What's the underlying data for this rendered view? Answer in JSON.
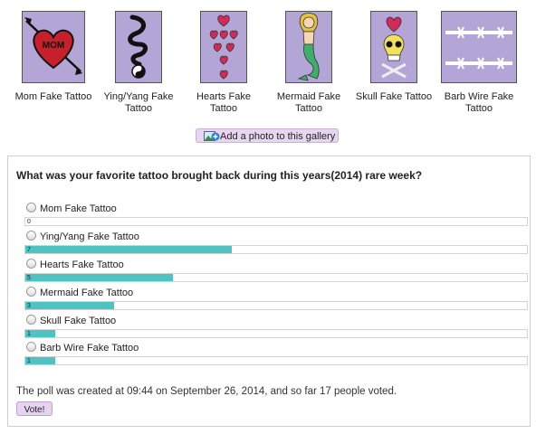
{
  "gallery": {
    "items": [
      {
        "caption": "Mom Fake Tattoo",
        "art_text": "MOM"
      },
      {
        "caption": "Ying/Yang Fake Tattoo"
      },
      {
        "caption": "Hearts Fake Tattoo"
      },
      {
        "caption": "Mermaid Fake Tattoo"
      },
      {
        "caption": "Skull Fake Tattoo"
      },
      {
        "caption": "Barb Wire Fake Tattoo"
      }
    ],
    "add_photo_label": "Add a photo to this gallery"
  },
  "poll": {
    "question": "What was your favorite tattoo brought back during this years(2014) rare week?",
    "options": [
      {
        "label": "Mom Fake Tattoo",
        "votes": "0"
      },
      {
        "label": "Ying/Yang Fake Tattoo",
        "votes": "7"
      },
      {
        "label": "Hearts Fake Tattoo",
        "votes": "5"
      },
      {
        "label": "Mermaid Fake Tattoo",
        "votes": "3"
      },
      {
        "label": "Skull Fake Tattoo",
        "votes": "1"
      },
      {
        "label": "Barb Wire Fake Tattoo",
        "votes": "1"
      }
    ],
    "total_votes": 17,
    "summary": "The poll was created at 09:44 on September 26, 2014, and so far 17 people voted.",
    "vote_button": "Vote!",
    "bar_color": "#4fc3c4"
  }
}
